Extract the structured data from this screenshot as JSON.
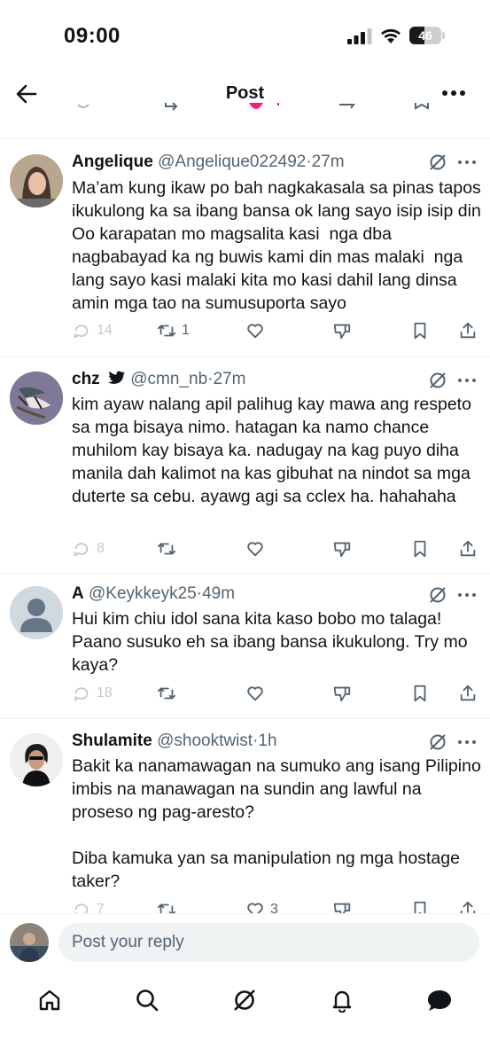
{
  "status_bar": {
    "time": "09:00",
    "battery": "46",
    "battery_level": 0.46
  },
  "header": {
    "title": "Post"
  },
  "replies": [
    {
      "name": "Angelique",
      "handle": "@Angelique022492",
      "separator": "·",
      "time": "27m",
      "verified": false,
      "text": "Ma’am kung ikaw po bah nagkakasala sa pinas tapos ikukulong ka sa ibang bansa ok lang sayo isip isip din Oo karapatan mo magsalita kasi  nga dba nagbabayad ka ng buwis kami din mas malaki  nga lang sayo kasi malaki kita mo kasi dahil lang dinsa amin mga tao na sumusuporta sayo",
      "replies": "14",
      "reposts": "1",
      "likes": ""
    },
    {
      "name": "chz",
      "handle": "@cmn_nb",
      "separator": "·",
      "time": "27m",
      "verified": true,
      "text": "kim ayaw nalang apil palihug kay mawa ang respeto sa mga bisaya nimo. hatagan ka namo chance muhilom kay bisaya ka. nadugay na kag puyo diha manila dah kalimot na kas gibuhat na nindot sa mga duterte sa cebu. ayawg agi sa cclex ha. hahahaha",
      "replies": "8",
      "reposts": "",
      "likes": ""
    },
    {
      "name": "A",
      "handle": "@Keykkeyk25",
      "separator": "·",
      "time": "49m",
      "verified": false,
      "text": "Hui kim chiu idol sana kita kaso bobo mo talaga! Paano susuko eh sa ibang bansa ikukulong. Try mo kaya?",
      "replies": "18",
      "reposts": "",
      "likes": ""
    },
    {
      "name": "Shulamite",
      "handle": "@shooktwist",
      "separator": "·",
      "time": "1h",
      "verified": false,
      "text": "Bakit ka nanamawagan na sumuko ang isang Pilipino imbis na manawagan na sundin ang lawful na proseso ng pag-aresto?\n\nDiba kamuka yan sa manipulation ng mga hostage taker?",
      "replies": "7",
      "reposts": "",
      "likes": "3"
    }
  ],
  "composer": {
    "placeholder": "Post your reply"
  },
  "nav": [
    "home-icon",
    "search-icon",
    "grok-icon",
    "notifications-icon",
    "messages-icon"
  ],
  "colors": {
    "text": "#0f1419",
    "secondary": "#536471",
    "divider": "#eff3f4",
    "accent_pink": "#f91880"
  }
}
